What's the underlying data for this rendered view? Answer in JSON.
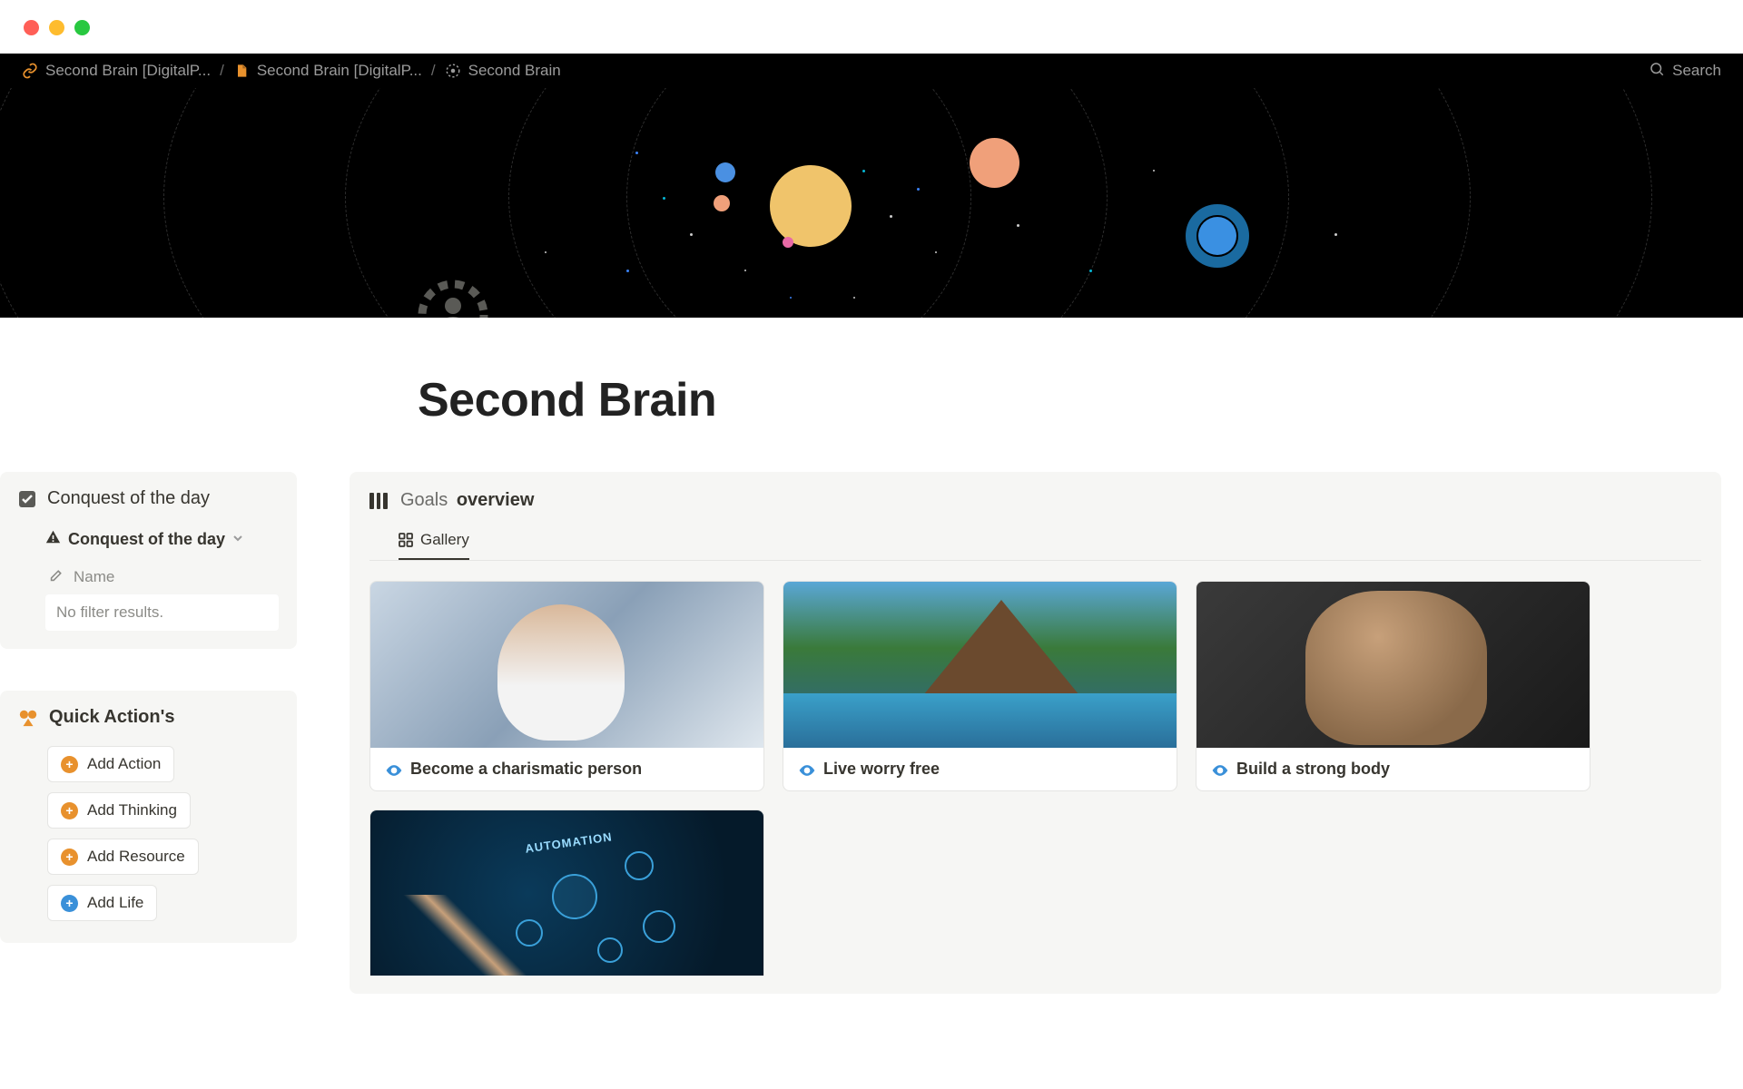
{
  "breadcrumbs": [
    {
      "label": "Second Brain [DigitalP...",
      "icon": "link"
    },
    {
      "label": "Second Brain [DigitalP...",
      "icon": "doc"
    },
    {
      "label": "Second Brain",
      "icon": "target"
    }
  ],
  "search_label": "Search",
  "page": {
    "title": "Second Brain"
  },
  "conquest": {
    "panel_title": "Conquest of the day",
    "db_title": "Conquest of the day",
    "name_label": "Name",
    "empty_text": "No filter results."
  },
  "quick_actions": {
    "title": "Quick Action's",
    "buttons": [
      {
        "label": "Add Action",
        "color": "orange"
      },
      {
        "label": "Add Thinking",
        "color": "orange"
      },
      {
        "label": "Add Resource",
        "color": "orange"
      },
      {
        "label": "Add Life",
        "color": "blue"
      }
    ]
  },
  "goals": {
    "title_light": "Goals",
    "title_bold": "overview",
    "view_tab": "Gallery",
    "cards": [
      {
        "title": "Become a charismatic person",
        "img": "person"
      },
      {
        "title": "Live worry free",
        "img": "resort"
      },
      {
        "title": "Build a strong body",
        "img": "body"
      },
      {
        "title": "",
        "img": "auto"
      }
    ]
  }
}
